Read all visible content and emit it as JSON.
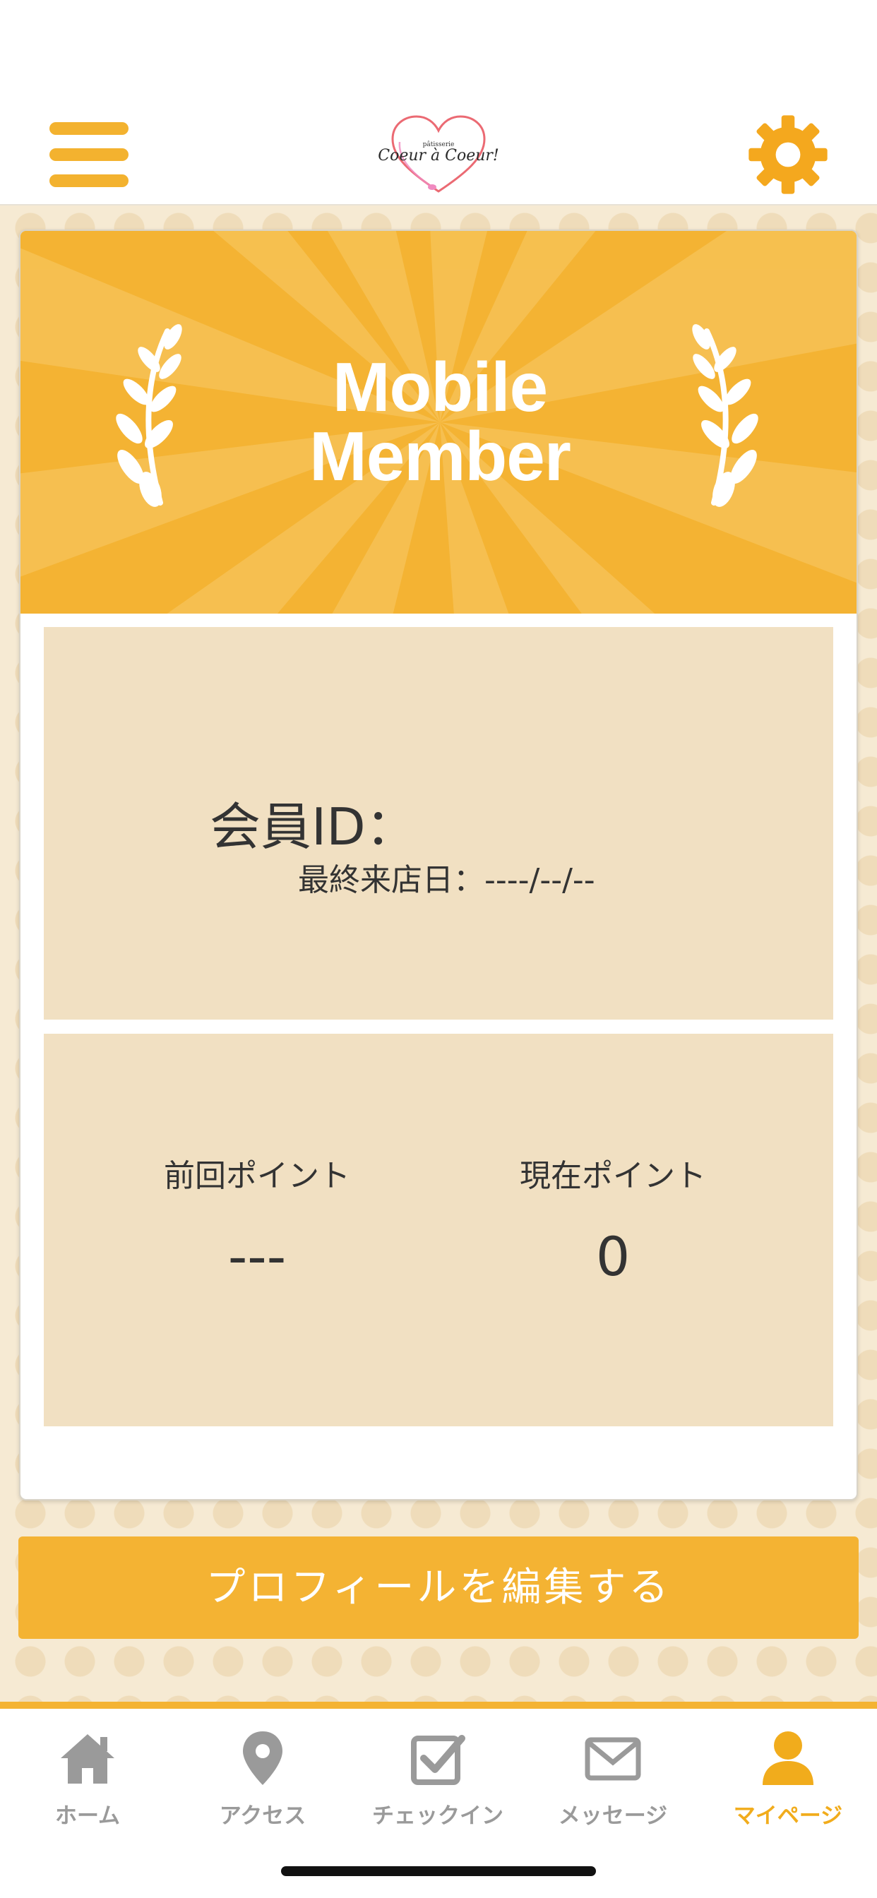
{
  "app": {
    "logo_text": "Coeur à Coeur!",
    "logo_subtext": "pâtisserie",
    "accent_color": "#f4b333"
  },
  "header": {
    "menu_icon": "hamburger-menu-icon",
    "settings_icon": "gear-icon"
  },
  "banner": {
    "title_line1": "Mobile",
    "title_line2": "Member"
  },
  "member": {
    "id_label": "会員ID：",
    "last_visit_label": "最終来店日：----/--/--"
  },
  "points": {
    "previous_label": "前回ポイント",
    "previous_value": "---",
    "current_label": "現在ポイント",
    "current_value": "0"
  },
  "edit_profile_button": "プロフィールを編集する",
  "tabs": [
    {
      "label": "ホーム",
      "icon": "home-icon",
      "active": false
    },
    {
      "label": "アクセス",
      "icon": "map-pin-icon",
      "active": false
    },
    {
      "label": "チェックイン",
      "icon": "checkbox-icon",
      "active": false
    },
    {
      "label": "メッセージ",
      "icon": "envelope-icon",
      "active": false
    },
    {
      "label": "マイページ",
      "icon": "person-icon",
      "active": true
    }
  ]
}
